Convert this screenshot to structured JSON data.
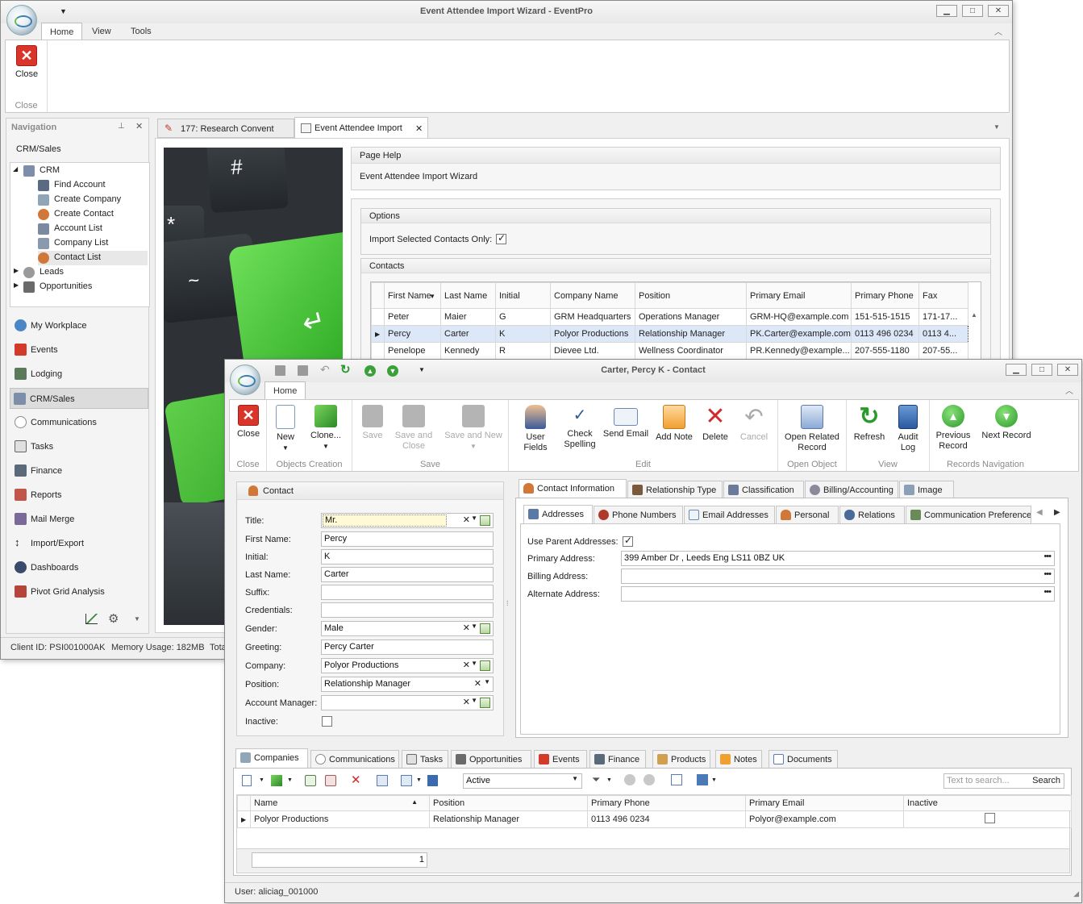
{
  "main_window": {
    "title": "Event Attendee Import Wizard - EventPro",
    "ribbon_tabs": [
      "Home",
      "View",
      "Tools"
    ],
    "close_button": "Close",
    "close_group": "Close",
    "nav": {
      "header": "Navigation",
      "section": "CRM/Sales",
      "tree": {
        "crm": "CRM",
        "children": [
          "Find Account",
          "Create Company",
          "Create Contact",
          "Account List",
          "Company List",
          "Contact List"
        ],
        "leads": "Leads",
        "opportunities": "Opportunities"
      },
      "items": [
        "My Workplace",
        "Events",
        "Lodging",
        "CRM/Sales",
        "Communications",
        "Tasks",
        "Finance",
        "Reports",
        "Mail Merge",
        "Import/Export",
        "Dashboards",
        "Pivot Grid Analysis"
      ]
    },
    "doc_tabs": [
      "177: Research Convent",
      "Event Attendee Import"
    ],
    "page_help": {
      "header": "Page Help",
      "text": "Event Attendee Import Wizard"
    },
    "options": {
      "header": "Options",
      "import_selected_label": "Import Selected Contacts Only:",
      "import_selected": true
    },
    "contacts": {
      "header": "Contacts",
      "columns": [
        "First Name",
        "Last Name",
        "Initial",
        "Company Name",
        "Position",
        "Primary Email",
        "Primary Phone",
        "Fax"
      ],
      "rows": [
        [
          "Peter",
          "Maier",
          "G",
          "GRM Headquarters",
          "Operations Manager",
          "GRM-HQ@example.com",
          "151-515-1515",
          "171-17..."
        ],
        [
          "Percy",
          "Carter",
          "K",
          "Polyor Productions",
          "Relationship Manager",
          "PK.Carter@example.com",
          "0113 496 0234",
          "0113 4..."
        ],
        [
          "Penelope",
          "Kennedy",
          "R",
          "Dievee Ltd.",
          "Wellness Coordinator",
          "PR.Kennedy@example...",
          "207-555-1180",
          "207-55..."
        ]
      ]
    },
    "status": {
      "client_id": "Client ID: PSI001000AK",
      "memory": "Memory Usage: 182MB",
      "tot": "Tota"
    }
  },
  "contact_window": {
    "title": "Carter, Percy K - Contact",
    "ribbon_tab": "Home",
    "groups": {
      "close": {
        "label": "Close",
        "buttons": [
          "Close"
        ]
      },
      "objects": {
        "label": "Objects Creation",
        "buttons": [
          "New",
          "Clone..."
        ]
      },
      "save": {
        "label": "Save",
        "buttons": [
          "Save",
          "Save and Close",
          "Save and New"
        ]
      },
      "edit": {
        "label": "Edit",
        "buttons": [
          "User Fields",
          "Check Spelling",
          "Send Email",
          "Add Note",
          "Delete",
          "Cancel"
        ]
      },
      "open": {
        "label": "Open Object",
        "buttons": [
          "Open Related Record"
        ]
      },
      "view": {
        "label": "View",
        "buttons": [
          "Refresh",
          "Audit Log"
        ]
      },
      "nav": {
        "label": "Records Navigation",
        "buttons": [
          "Previous Record",
          "Next Record"
        ]
      }
    },
    "contact_panel": {
      "header": "Contact",
      "fields": [
        {
          "label": "Title:",
          "value": "Mr."
        },
        {
          "label": "First Name:",
          "value": "Percy"
        },
        {
          "label": "Initial:",
          "value": "K"
        },
        {
          "label": "Last Name:",
          "value": "Carter"
        },
        {
          "label": "Suffix:",
          "value": ""
        },
        {
          "label": "Credentials:",
          "value": ""
        },
        {
          "label": "Gender:",
          "value": "Male"
        },
        {
          "label": "Greeting:",
          "value": "Percy Carter"
        },
        {
          "label": "Company:",
          "value": "Polyor Productions"
        },
        {
          "label": "Position:",
          "value": "Relationship Manager"
        },
        {
          "label": "Account Manager:",
          "value": ""
        },
        {
          "label": "Inactive:",
          "value": ""
        }
      ]
    },
    "info_tabs": [
      "Contact Information",
      "Relationship Type",
      "Classification",
      "Billing/Accounting",
      "Image"
    ],
    "sub_tabs": [
      "Addresses",
      "Phone Numbers",
      "Email Addresses",
      "Personal",
      "Relations",
      "Communication Preferences"
    ],
    "addresses": {
      "use_parent_label": "Use Parent Addresses:",
      "use_parent": true,
      "primary_label": "Primary Address:",
      "primary_value": "399 Amber Dr , Leeds Eng LS11 0BZ UK",
      "billing_label": "Billing Address:",
      "billing_value": "",
      "alternate_label": "Alternate Address:",
      "alternate_value": ""
    },
    "bottom_tabs": [
      "Companies",
      "Communications",
      "Tasks",
      "Opportunities",
      "Events",
      "Finance",
      "Products",
      "Notes",
      "Documents"
    ],
    "grid_toolbar": {
      "filter_value": "Active",
      "search_placeholder": "Text to search...",
      "search_button": "Search"
    },
    "companies_grid": {
      "columns": [
        "Name",
        "Position",
        "Primary Phone",
        "Primary Email",
        "Inactive"
      ],
      "rows": [
        [
          "Polyor Productions",
          "Relationship Manager",
          "0113 496 0234",
          "Polyor@example.com",
          ""
        ]
      ],
      "footer_count": "1"
    },
    "status": "User: aliciag_001000"
  },
  "colors": {
    "accent_green": "#4cc43a",
    "selection": "#dce8f7",
    "frame": "#f0f0f0"
  }
}
